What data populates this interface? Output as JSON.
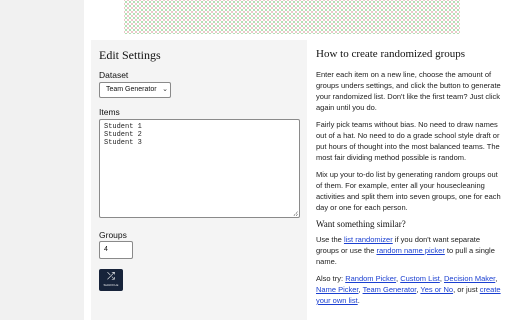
{
  "settings": {
    "title": "Edit Settings",
    "dataset_label": "Dataset",
    "dataset_value": "Team Generator",
    "items_label": "Items",
    "items": [
      "Student 1",
      "Student 2",
      "Student 3"
    ],
    "groups_label": "Groups",
    "groups_value": "4",
    "shuffle_icon": "shuffle-icon",
    "shuffle_caption": "SHUFFLE"
  },
  "info": {
    "title": "How to create randomized groups",
    "p1": [
      "Enter each item on a new line, choose the amount of",
      "groups unders settings, and click the button to generate",
      "your randomized list. Don't like the first team? Just click",
      "again until you do."
    ],
    "p2": [
      "Fairly pick teams without bias. No need to draw names",
      "out of a hat. No need to do a grade school style draft or",
      "put hours of thought into the most balanced teams. The",
      "most fair dividing method possible is random."
    ],
    "p3": [
      "Mix up your to-do list by generating random groups out",
      "of them. For example, enter all your housecleaning",
      "activities and split them into seven groups, one for each",
      "day or one for each person."
    ],
    "similar_title": "Want something similar?",
    "p4": {
      "use": "Use the ",
      "link1": "list randomizer",
      "mid1": " if you don't want separate",
      "line2_pre": "groups or use the ",
      "link2": "random name picker",
      "mid2": " to pull a single",
      "line3": "name."
    },
    "p5": {
      "also": "Also try: ",
      "links_line1": [
        "Random Picker",
        "Custom List",
        "Decision Maker"
      ],
      "links_line2": [
        "Name Picker",
        "Team Generator",
        "Yes or No"
      ],
      "or_just": ", or just ",
      "create_a": "create",
      "create_b": "your own list",
      "end": "."
    }
  }
}
